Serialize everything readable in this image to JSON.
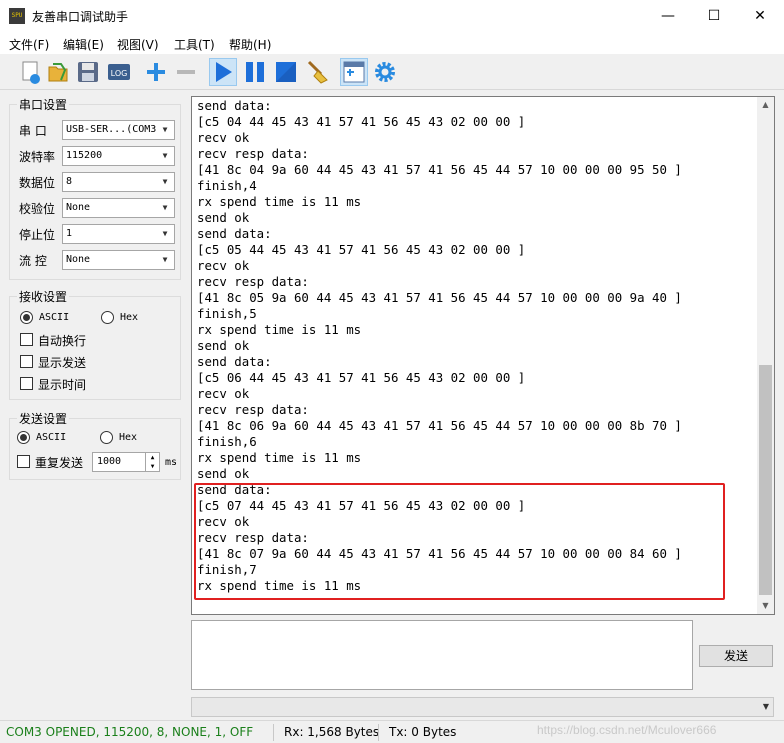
{
  "window": {
    "title": "友善串口调试助手",
    "app_icon_text": "SPU",
    "minimize": "—",
    "maximize": "☐",
    "close": "✕"
  },
  "menu": [
    "文件(F)",
    "编辑(E)",
    "视图(V)",
    "工具(T)",
    "帮助(H)"
  ],
  "toolbar": {
    "icons": [
      "new-icon",
      "open-folder-icon",
      "save-icon",
      "log-icon",
      "add-icon",
      "remove-icon",
      "play-icon",
      "pause-icon",
      "stop-icon",
      "clear-broom-icon",
      "window-layout-icon",
      "settings-gear-icon"
    ],
    "log_label": "LOG"
  },
  "serial_settings": {
    "title": "串口设置",
    "rows": [
      {
        "label": "串  口",
        "value": "USB-SER...(COM3"
      },
      {
        "label": "波特率",
        "value": "115200"
      },
      {
        "label": "数据位",
        "value": "8"
      },
      {
        "label": "校验位",
        "value": "None"
      },
      {
        "label": "停止位",
        "value": "1"
      },
      {
        "label": "流  控",
        "value": "None"
      }
    ]
  },
  "receive_settings": {
    "title": "接收设置",
    "ascii": "ASCII",
    "hex": "Hex",
    "auto_wrap": "自动换行",
    "show_send": "显示发送",
    "show_time": "显示时间"
  },
  "send_settings": {
    "title": "发送设置",
    "ascii": "ASCII",
    "hex": "Hex",
    "repeat": "重复发送",
    "interval": "1000",
    "unit": "ms"
  },
  "rx_lines": [
    "send data:",
    "[c5 04 44 45 43 41 57 41 56 45 43 02 00 00 ]",
    "recv ok",
    "recv resp data:",
    "[41 8c 04 9a 60 44 45 43 41 57 41 56 45 44 57 10 00 00 00 95 50 ]",
    "finish,4",
    "rx spend time is 11 ms",
    "send ok",
    "send data:",
    "[c5 05 44 45 43 41 57 41 56 45 43 02 00 00 ]",
    "recv ok",
    "recv resp data:",
    "[41 8c 05 9a 60 44 45 43 41 57 41 56 45 44 57 10 00 00 00 9a 40 ]",
    "finish,5",
    "rx spend time is 11 ms",
    "send ok",
    "send data:",
    "[c5 06 44 45 43 41 57 41 56 45 43 02 00 00 ]",
    "recv ok",
    "recv resp data:",
    "[41 8c 06 9a 60 44 45 43 41 57 41 56 45 44 57 10 00 00 00 8b 70 ]",
    "finish,6",
    "rx spend time is 11 ms",
    "send ok",
    "send data:",
    "[c5 07 44 45 43 41 57 41 56 45 43 02 00 00 ]",
    "recv ok",
    "recv resp data:",
    "[41 8c 07 9a 60 44 45 43 41 57 41 56 45 44 57 10 00 00 00 84 60 ]",
    "finish,7",
    "rx spend time is 11 ms"
  ],
  "send_button": "发送",
  "status": {
    "port": "COM3 OPENED, 115200, 8, NONE, 1, OFF",
    "rx": "Rx: 1,568 Bytes",
    "tx": "Tx: 0 Bytes",
    "watermark": "https://blog.csdn.net/Mculover666"
  },
  "colors": {
    "port_status": "#1a7f1a",
    "highlight_box": "#e02020",
    "toolbar_blue": "#1e6fd9"
  }
}
